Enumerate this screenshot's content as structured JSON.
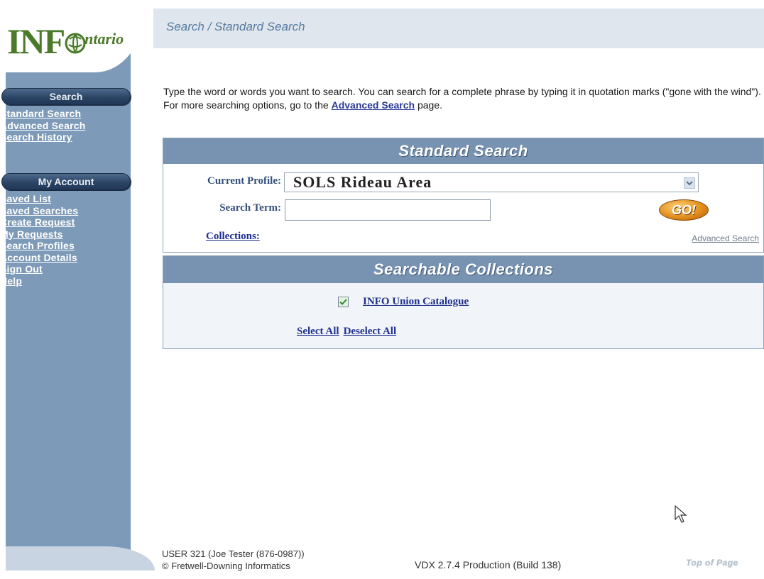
{
  "app": {
    "logo_text_info": "INF",
    "logo_text_ontario": "ntario"
  },
  "sidebar": {
    "search_section": {
      "title": "Search",
      "items": [
        "Standard Search",
        "Advanced Search",
        "Search History"
      ]
    },
    "account_section": {
      "title": "My Account",
      "items": [
        "Saved List",
        "Saved Searches",
        "Create Request",
        "My Requests",
        "Search Profiles",
        "Account Details",
        "Sign Out",
        "Help"
      ]
    }
  },
  "header": {
    "breadcrumb": "Search / Standard Search"
  },
  "intro": {
    "text_before": "Type the word or words you want to search. You can search for a complete phrase by typing it in quotation marks (\"gone with the wind\"). For more searching options, go to the ",
    "link_text": "Advanced Search",
    "text_after": " page."
  },
  "standard_search": {
    "title": "Standard Search",
    "profile_label": "Current Profile:",
    "profile_value": "SOLS Rideau Area",
    "term_label": "Search Term:",
    "term_value": "",
    "go_label": "GO!",
    "collections_link": "Collections:",
    "advanced_link": "Advanced Search"
  },
  "collections": {
    "title": "Searchable Collections",
    "items": [
      {
        "label": "INFO Union Catalogue",
        "checked": true
      }
    ],
    "select_all": "Select All",
    "deselect_all": "Deselect All"
  },
  "footer": {
    "user_line": "USER 321 (Joe Tester (876-0987))",
    "copyright_line": "© Fretwell-Downing Informatics",
    "version": "VDX 2.7.4 Production (Build 138)",
    "vendor_logo": "Top of Page"
  },
  "colors": {
    "sidebar": "#7d9ab8",
    "pill": "#2c4565",
    "panel_bar": "#7893b2",
    "link": "#1e2f8e",
    "go_button": "#e28f1c"
  }
}
